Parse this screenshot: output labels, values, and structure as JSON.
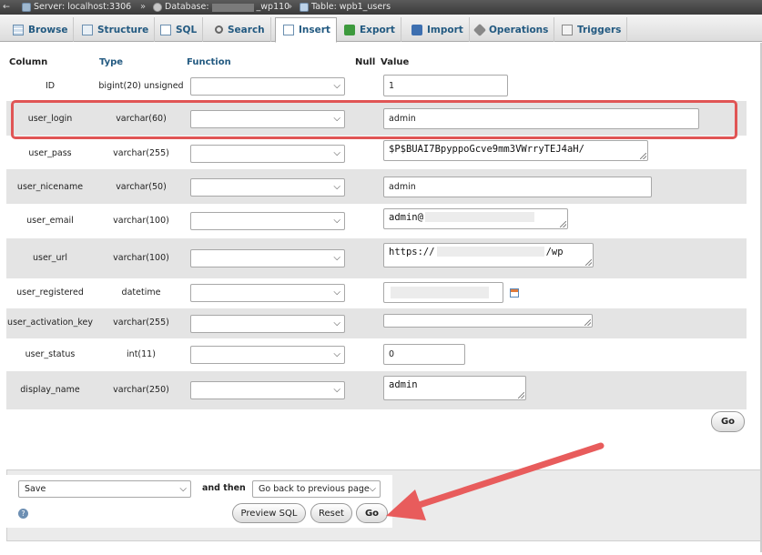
{
  "breadcrumb": {
    "server_label": "Server: localhost:3306",
    "database_label": "Database:",
    "database_suffix": "_wp110",
    "table_label": "Table: wpb1_users",
    "separator": "»"
  },
  "tabs": [
    {
      "label": "Browse",
      "icon": "browse-icon"
    },
    {
      "label": "Structure",
      "icon": "structure-icon"
    },
    {
      "label": "SQL",
      "icon": "sql-icon"
    },
    {
      "label": "Search",
      "icon": "search-icon"
    },
    {
      "label": "Insert",
      "icon": "insert-icon",
      "active": true
    },
    {
      "label": "Export",
      "icon": "export-icon"
    },
    {
      "label": "Import",
      "icon": "import-icon"
    },
    {
      "label": "Operations",
      "icon": "operations-icon"
    },
    {
      "label": "Triggers",
      "icon": "triggers-icon"
    }
  ],
  "columns_header": {
    "column": "Column",
    "type": "Type",
    "function": "Function",
    "null": "Null",
    "value": "Value"
  },
  "rows": [
    {
      "column": "ID",
      "type": "bigint(20) unsigned",
      "value": "1"
    },
    {
      "column": "user_login",
      "type": "varchar(60)",
      "value": "admin"
    },
    {
      "column": "user_pass",
      "type": "varchar(255)",
      "value": "$P$BUAI7BpyppoGcve9mm3VWrryTEJ4aH/"
    },
    {
      "column": "user_nicename",
      "type": "varchar(50)",
      "value": "admin"
    },
    {
      "column": "user_email",
      "type": "varchar(100)",
      "value": "admin@"
    },
    {
      "column": "user_url",
      "type": "varchar(100)",
      "value_prefix": "https://",
      "value_suffix": "/wp"
    },
    {
      "column": "user_registered",
      "type": "datetime",
      "value": ""
    },
    {
      "column": "user_activation_key",
      "type": "varchar(255)",
      "value": ""
    },
    {
      "column": "user_status",
      "type": "int(11)",
      "value": "0"
    },
    {
      "column": "display_name",
      "type": "varchar(250)",
      "value": "admin"
    }
  ],
  "go_button": "Go",
  "footer": {
    "action_select": "Save",
    "and_then_label": "and then",
    "then_select": "Go back to previous page",
    "preview_sql": "Preview SQL",
    "reset": "Reset",
    "go": "Go"
  },
  "colors": {
    "highlight_box": "#e05555",
    "arrow": "#e85c5c",
    "link_blue": "#235a81"
  }
}
